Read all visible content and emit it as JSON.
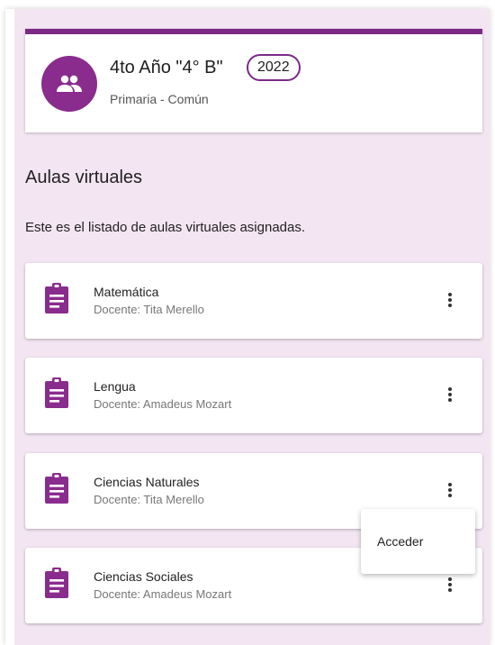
{
  "course": {
    "title": "4to Año \"4° B\"",
    "year": "2022",
    "subtitle": "Primaria - Común",
    "avatar_icon": "group-icon"
  },
  "section": {
    "title": "Aulas virtuales",
    "description": "Este es el listado de aulas virtuales asignadas."
  },
  "rooms": [
    {
      "name": "Matemática",
      "teacher": "Docente: Tita Merello",
      "icon": "assignment-icon"
    },
    {
      "name": "Lengua",
      "teacher": "Docente: Amadeus Mozart",
      "icon": "assignment-icon"
    },
    {
      "name": "Ciencias Naturales",
      "teacher": "Docente: Tita Merello",
      "icon": "assignment-icon"
    },
    {
      "name": "Ciencias Sociales",
      "teacher": "Docente: Amadeus Mozart",
      "icon": "assignment-icon"
    }
  ],
  "menu": {
    "items": [
      {
        "label": "Acceder"
      }
    ]
  },
  "colors": {
    "accent": "#7b2a87",
    "background": "#f3e6f2"
  }
}
